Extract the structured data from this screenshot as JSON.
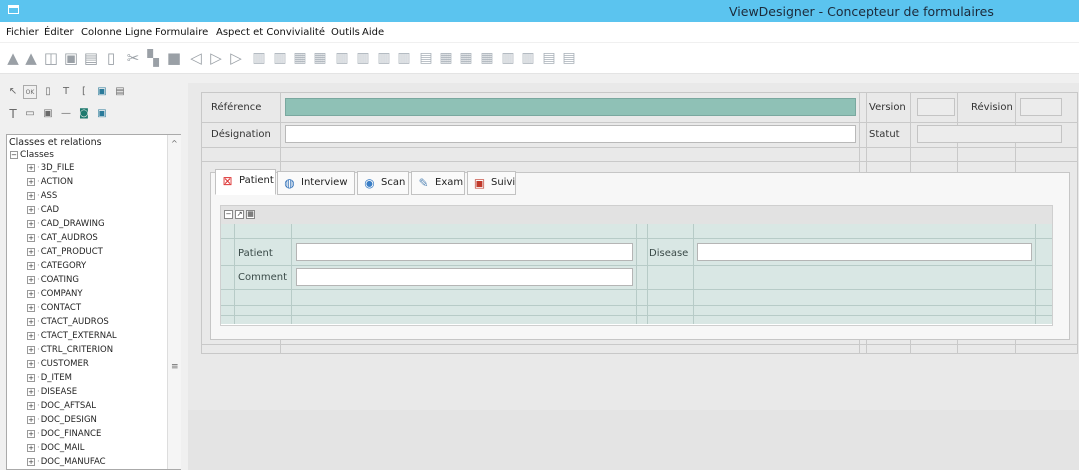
{
  "window": {
    "title": "ViewDesigner - Concepteur de formulaires",
    "icon": "window-icon"
  },
  "menu": {
    "items": [
      "Fichier",
      "Éditer",
      "Colonne",
      "Ligne",
      "Formulaire",
      "Aspect et Convivialité",
      "Outils",
      "Aide"
    ]
  },
  "toolbar": {
    "icons": [
      "import-icon",
      "export-icon",
      "open-icon",
      "save-icon",
      "save-as-icon",
      "new-icon",
      "cut-icon",
      "copy-icon",
      "paste-icon",
      "back-icon",
      "forward-icon",
      "play-icon",
      "insert-column-icon",
      "insert-column-2-icon",
      "merge-columns-icon",
      "split-columns-icon",
      "align-columns-icon",
      "distribute-columns-icon",
      "column-width-icon",
      "column-props-icon",
      "insert-row-icon",
      "insert-row-2-icon",
      "merge-rows-icon",
      "split-rows-icon",
      "align-rows-icon",
      "distribute-rows-icon",
      "row-height-icon",
      "row-props-icon"
    ]
  },
  "palette": {
    "icons": [
      "pointer-icon",
      "checkbox-tool-icon",
      "frame-tool-icon",
      "text-tool-icon",
      "line-tool-icon",
      "image-tool-icon",
      "picture-tool-icon",
      "label-tool-icon",
      "textbox-tool-icon",
      "list-tool-icon",
      "separator-tool-icon",
      "button-tool-icon",
      "photo-tool-icon"
    ]
  },
  "tree": {
    "header": "Classes et relations",
    "root": "Classes",
    "items": [
      "3D_FILE",
      "ACTION",
      "ASS",
      "CAD",
      "CAD_DRAWING",
      "CAT_AUDROS",
      "CAT_PRODUCT",
      "CATEGORY",
      "COATING",
      "COMPANY",
      "CONTACT",
      "CTACT_AUDROS",
      "CTACT_EXTERNAL",
      "CTRL_CRITERION",
      "CUSTOMER",
      "D_ITEM",
      "DISEASE",
      "DOC_AFTSAL",
      "DOC_DESIGN",
      "DOC_FINANCE",
      "DOC_MAIL",
      "DOC_MANUFAC"
    ]
  },
  "form": {
    "reference_label": "Référence",
    "designation_label": "Désignation",
    "version_label": "Version",
    "revision_label": "Révision",
    "status_label": "Statut"
  },
  "tabs": [
    {
      "label": "Patient",
      "icon": "patient-icon",
      "active": true
    },
    {
      "label": "Interview",
      "icon": "interview-icon",
      "active": false
    },
    {
      "label": "Scan",
      "icon": "scan-icon",
      "active": false
    },
    {
      "label": "Exam",
      "icon": "exam-icon",
      "active": false
    },
    {
      "label": "Suivi",
      "icon": "suivi-icon",
      "active": false
    }
  ],
  "grid": {
    "patient_label": "Patient",
    "disease_label": "Disease",
    "comment_label": "Comment"
  },
  "colors": {
    "titlebar": "#5bc4ef",
    "reference_field": "#8fc1b6",
    "grid_background": "#d9e7e4"
  }
}
